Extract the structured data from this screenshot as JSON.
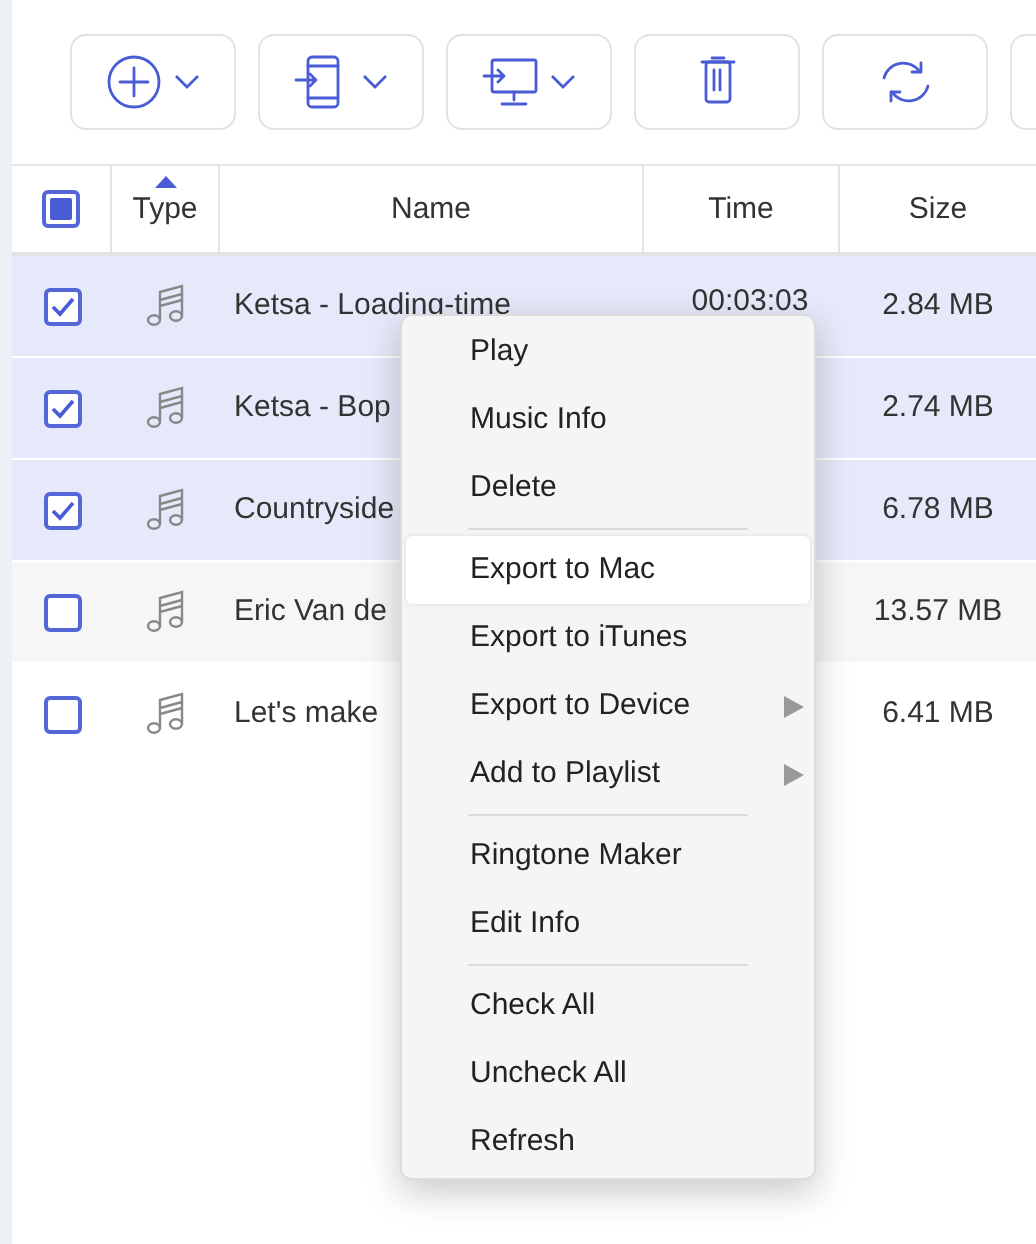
{
  "toolbar": [
    {
      "kind": "add",
      "dropdown": true
    },
    {
      "kind": "to-phone",
      "dropdown": true
    },
    {
      "kind": "to-computer",
      "dropdown": true
    },
    {
      "kind": "delete",
      "dropdown": false
    },
    {
      "kind": "refresh",
      "dropdown": false
    },
    {
      "kind": "blank"
    }
  ],
  "table": {
    "select_all_partial": true,
    "columns": [
      {
        "label": "Type",
        "sorted": true
      },
      {
        "label": "Name",
        "sorted": false
      },
      {
        "label": "Time",
        "sorted": false
      },
      {
        "label": "Size",
        "sorted": false
      }
    ],
    "rows": [
      {
        "checked": true,
        "name": "Ketsa - Loading-time",
        "time": "00:03:03",
        "size": "2.84 MB"
      },
      {
        "checked": true,
        "name": "Ketsa - Bop",
        "size": "2.74 MB"
      },
      {
        "checked": true,
        "name": "Countryside",
        "size": "6.78 MB"
      },
      {
        "checked": false,
        "name": "Eric Van de",
        "size": "13.57 MB"
      },
      {
        "checked": false,
        "name": "Let's make",
        "size": "6.41 MB"
      }
    ]
  },
  "context_menu": {
    "groups": [
      [
        {
          "label": "Play",
          "selected": false,
          "submenu": false
        },
        {
          "label": "Music Info",
          "selected": false,
          "submenu": false
        },
        {
          "label": "Delete",
          "selected": false,
          "submenu": false
        }
      ],
      [
        {
          "label": "Export to Mac",
          "selected": true,
          "submenu": false
        },
        {
          "label": "Export to iTunes",
          "selected": false,
          "submenu": false
        },
        {
          "label": "Export to Device",
          "selected": false,
          "submenu": true
        },
        {
          "label": "Add to Playlist",
          "selected": false,
          "submenu": true
        }
      ],
      [
        {
          "label": "Ringtone Maker",
          "selected": false,
          "submenu": false
        },
        {
          "label": "Edit Info",
          "selected": false,
          "submenu": false
        }
      ],
      [
        {
          "label": "Check All",
          "selected": false,
          "submenu": false
        },
        {
          "label": "Uncheck All",
          "selected": false,
          "submenu": false
        },
        {
          "label": "Refresh",
          "selected": false,
          "submenu": false
        }
      ]
    ]
  }
}
